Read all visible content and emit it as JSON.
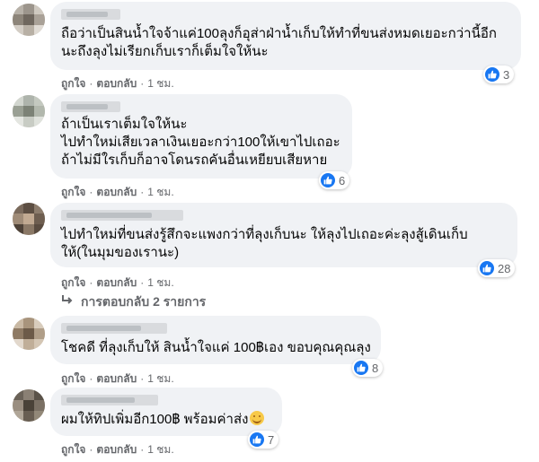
{
  "comments": [
    {
      "lines": [
        "ถือว่าเป็นสินน้ำใจจ้าแค่100ลุงก็อุส่าฝ่าน้ำเก็บให้ทำที่ขนส่งหมดเยอะกว่านี้อีก",
        "นะถึงลุงไม่เรียกเก็บเราก็เต็มใจให้นะ"
      ],
      "like_label": "ถูกใจ",
      "reply_label": "ตอบกลับ",
      "time": "1 ชม.",
      "reactions": "3"
    },
    {
      "lines": [
        "ถ้าเป็นเราเต็มใจให้นะ",
        "ไปทำใหม่เสียเวลาเงินเยอะกว่า100ให้เขาไปเถอะ",
        "ถ้าไม่มีใรเก็บก็อาจโดนรถคันอื่นเหยียบเสียหาย"
      ],
      "like_label": "ถูกใจ",
      "reply_label": "ตอบกลับ",
      "time": "1 ชม.",
      "reactions": "6"
    },
    {
      "lines": [
        "ไปทำใหม่ที่ขนส่งรู้สึกจะแพงกว่าที่ลุงเก็บนะ ให้ลุงไปเถอะค่ะลุงสู้เดินเก็บ",
        "ให้(ในมุมของเรานะ)"
      ],
      "like_label": "ถูกใจ",
      "reply_label": "ตอบกลับ",
      "time": "1 ชม.",
      "reactions": "28",
      "replies_label": "การตอบกลับ 2 รายการ"
    },
    {
      "lines": [
        "โชคดี ที่ลุงเก็บให้ สินน้ำใจแค่ 100฿เอง ขอบคุณคุณลุง"
      ],
      "like_label": "ถูกใจ",
      "reply_label": "ตอบกลับ",
      "time": "1 ชม.",
      "reactions": "8"
    },
    {
      "lines": [
        "ผมให้ทิปเพิ่มอีก100฿ พร้อมค่าส่ง"
      ],
      "like_label": "ถูกใจ",
      "reply_label": "ตอบกลับ",
      "time": "1 ชม.",
      "reactions": "7",
      "emoji": "relieved-face"
    }
  ],
  "colors": {
    "bubble": "#f0f2f5",
    "like": "#1877f2",
    "meta": "#65676b"
  }
}
